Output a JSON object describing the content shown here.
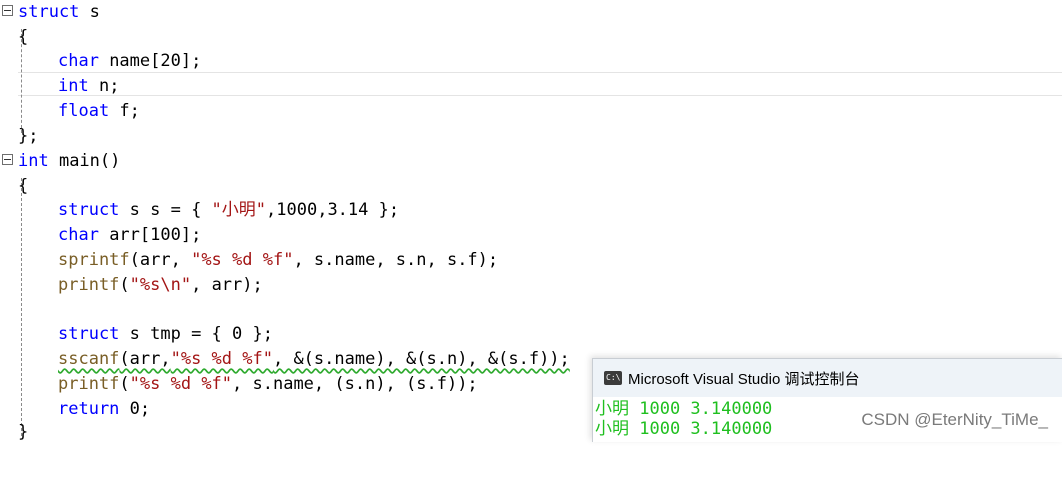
{
  "code_lines": {
    "l0": {
      "kw": "struct",
      "rest": " s"
    },
    "l1": {
      "text": "{"
    },
    "l2": {
      "kw": "char",
      "rest": " name[20];"
    },
    "l3": {
      "kw": "int",
      "rest": " n;"
    },
    "l4": {
      "kw": "float",
      "rest": " f;"
    },
    "l5": {
      "text": "};"
    },
    "l6": {
      "kw": "int",
      "rest": " main()"
    },
    "l7": {
      "text": "{"
    },
    "l8": {
      "kw": "struct",
      "rest": " s s = { ",
      "str": "\"小明\"",
      "tail": ",1000,3.14 };"
    },
    "l9": {
      "kw": "char",
      "rest": " arr[100];"
    },
    "l10": {
      "fn": "sprintf",
      "a": "(arr, ",
      "str": "\"%s %d %f\"",
      "tail": ", s.name, s.n, s.f);"
    },
    "l11": {
      "fn": "printf",
      "a": "(",
      "str": "\"%s\\n\"",
      "tail": ", arr);"
    },
    "l13": {
      "kw": "struct",
      "rest": " s tmp = { 0 };"
    },
    "l14": {
      "fn": "sscanf",
      "a": "(arr,",
      "str": "\"%s %d %f\"",
      "tail": ", &(s.name), &(s.n), &(s.f));"
    },
    "l15": {
      "fn": "printf",
      "a": "(",
      "str": "\"%s %d %f\"",
      "tail": ", s.name, (s.n), (s.f));"
    },
    "l16": {
      "kw": "return",
      "rest": " 0;"
    },
    "l17": {
      "text": "}"
    }
  },
  "console": {
    "title": "Microsoft Visual Studio 调试控制台",
    "icon": "console-app-icon",
    "icon_text": "C:\\",
    "output": [
      "小明 1000 3.140000",
      "小明 1000 3.140000"
    ]
  },
  "watermark": "CSDN @EterNity_TiMe_",
  "colors": {
    "keyword": "#0000ff",
    "string": "#a31515",
    "function": "#795e26",
    "output_text": "#1fbf1f"
  }
}
